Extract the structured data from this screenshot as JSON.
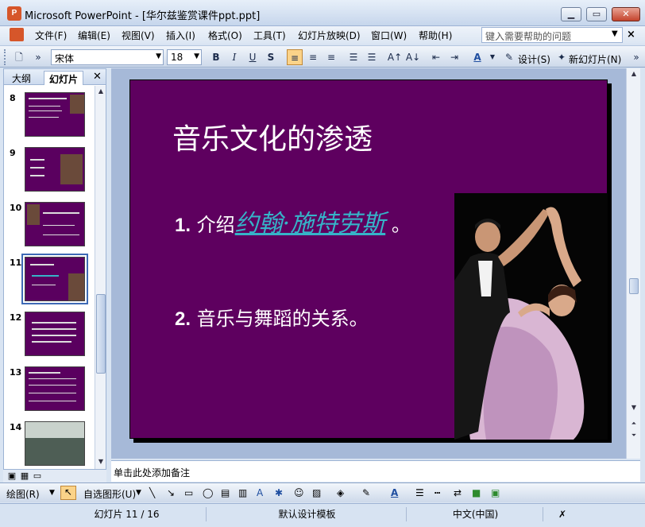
{
  "window": {
    "title": "Microsoft PowerPoint - [华尔兹鉴赏课件ppt.ppt]",
    "icon": "powerpoint-icon",
    "buttons": [
      "minimize",
      "maximize",
      "close"
    ]
  },
  "menubar": {
    "items": [
      "文件(F)",
      "编辑(E)",
      "视图(V)",
      "插入(I)",
      "格式(O)",
      "工具(T)",
      "幻灯片放映(D)",
      "窗口(W)",
      "帮助(H)"
    ],
    "help_placeholder": "键入需要帮助的问题"
  },
  "toolbar": {
    "font": "宋体",
    "font_size": "18",
    "bold": "B",
    "italic": "I",
    "underline": "U",
    "shadow": "S",
    "design_label": "设计(S)",
    "new_slide_label": "新幻灯片(N)"
  },
  "left_panel": {
    "tabs": [
      "大纲",
      "幻灯片"
    ],
    "active_tab": "幻灯片",
    "slide_numbers": [
      "8",
      "9",
      "10",
      "11",
      "12",
      "13",
      "14"
    ],
    "selected_slide": "11"
  },
  "slide": {
    "title": "音乐文化的渗透",
    "bullet1_num": "1.",
    "bullet1_text": "介绍",
    "bullet1_link": "约翰·施特劳斯",
    "bullet1_end": "。",
    "bullet2_num": "2.",
    "bullet2_text": "音乐与舞蹈的关系。",
    "background_color": "#5e005f",
    "link_color": "#36b3c8"
  },
  "notes": {
    "placeholder": "单击此处添加备注"
  },
  "drawing_toolbar": {
    "draw_label": "绘图(R)",
    "autoshapes_label": "自选图形(U)"
  },
  "statusbar": {
    "slide_position": "幻灯片 11 / 16",
    "template": "默认设计模板",
    "language": "中文(中国)"
  }
}
